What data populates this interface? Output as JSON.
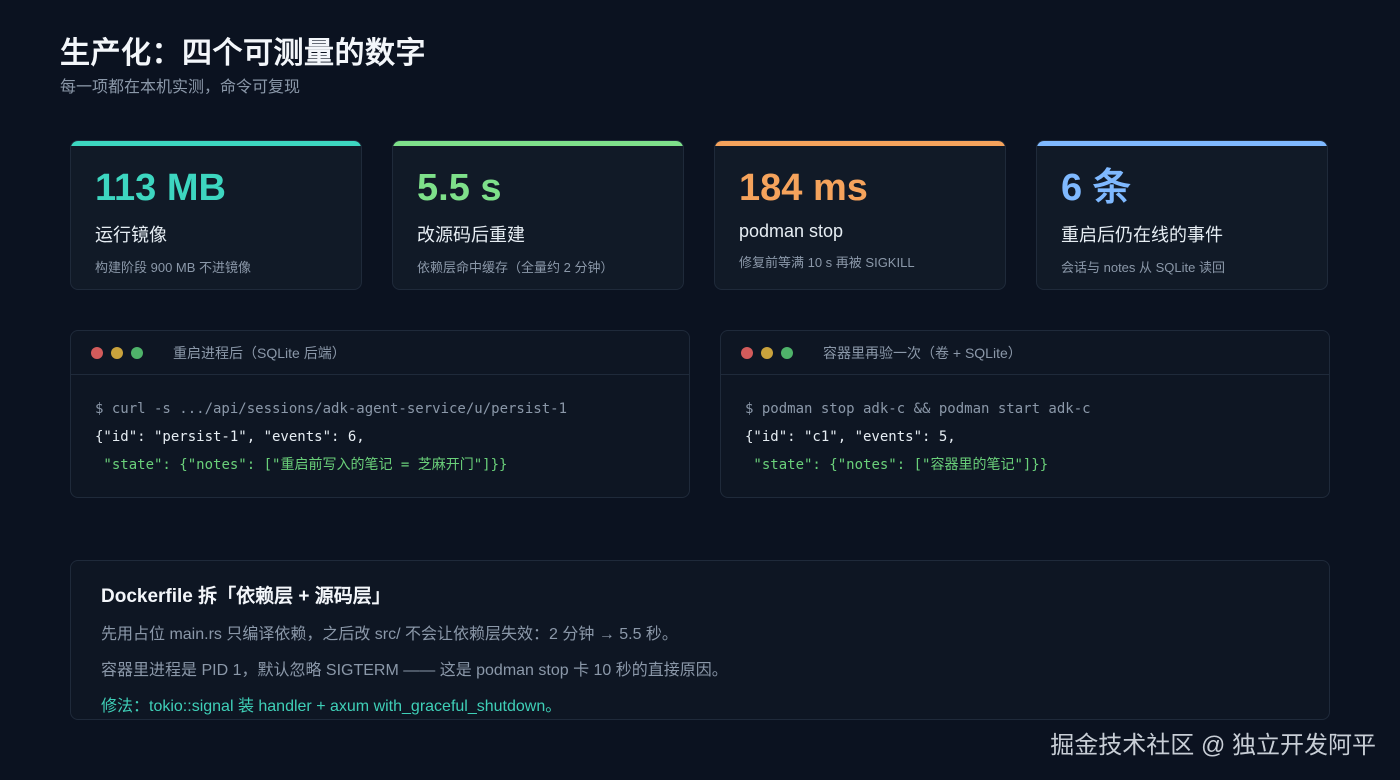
{
  "page": {
    "title": "生产化：四个可测量的数字",
    "subtitle": "每一项都在本机实测，命令可复现"
  },
  "stats": [
    {
      "value": "113 MB",
      "label": "运行镜像",
      "note": "构建阶段 900 MB 不进镜像",
      "color": "#3dd6c0"
    },
    {
      "value": "5.5 s",
      "label": "改源码后重建",
      "note": "依赖层命中缓存（全量约 2 分钟）",
      "color": "#7ee08a"
    },
    {
      "value": "184 ms",
      "label": "podman stop",
      "note": "修复前等满 10 s 再被 SIGKILL",
      "color": "#f5a35c"
    },
    {
      "value": "6 条",
      "label": "重启后仍在线的事件",
      "note": "会话与 notes 从 SQLite 读回",
      "color": "#7fb9ff"
    }
  ],
  "terminals": [
    {
      "title": "重启进程后（SQLite 后端）",
      "cmd": "$ curl -s .../api/sessions/adk-agent-service/u/persist-1",
      "out": "{\"id\": \"persist-1\", \"events\": 6,",
      "state_prefix": " \"state\": ",
      "state_value": "{\"notes\": [\"重启前写入的笔记 = 芝麻开门\"]}}"
    },
    {
      "title": "容器里再验一次（卷 + SQLite）",
      "cmd": "$ podman stop adk-c && podman start adk-c",
      "out": "{\"id\": \"c1\", \"events\": 5,",
      "state_prefix": " \"state\": ",
      "state_value": "{\"notes\": [\"容器里的笔记\"]}}"
    }
  ],
  "notes": {
    "title": "Dockerfile 拆「依赖层 + 源码层」",
    "line1": "先用占位 main.rs 只编译依赖，之后改 src/ 不会让依赖层失效：2 分钟 → 5.5 秒。",
    "line2": "容器里进程是 PID 1，默认忽略 SIGTERM —— 这是 podman stop 卡 10 秒的直接原因。",
    "fix": "修法：tokio::signal 装 handler + axum with_graceful_shutdown。"
  },
  "watermark": "掘金技术社区 @ 独立开发阿平"
}
